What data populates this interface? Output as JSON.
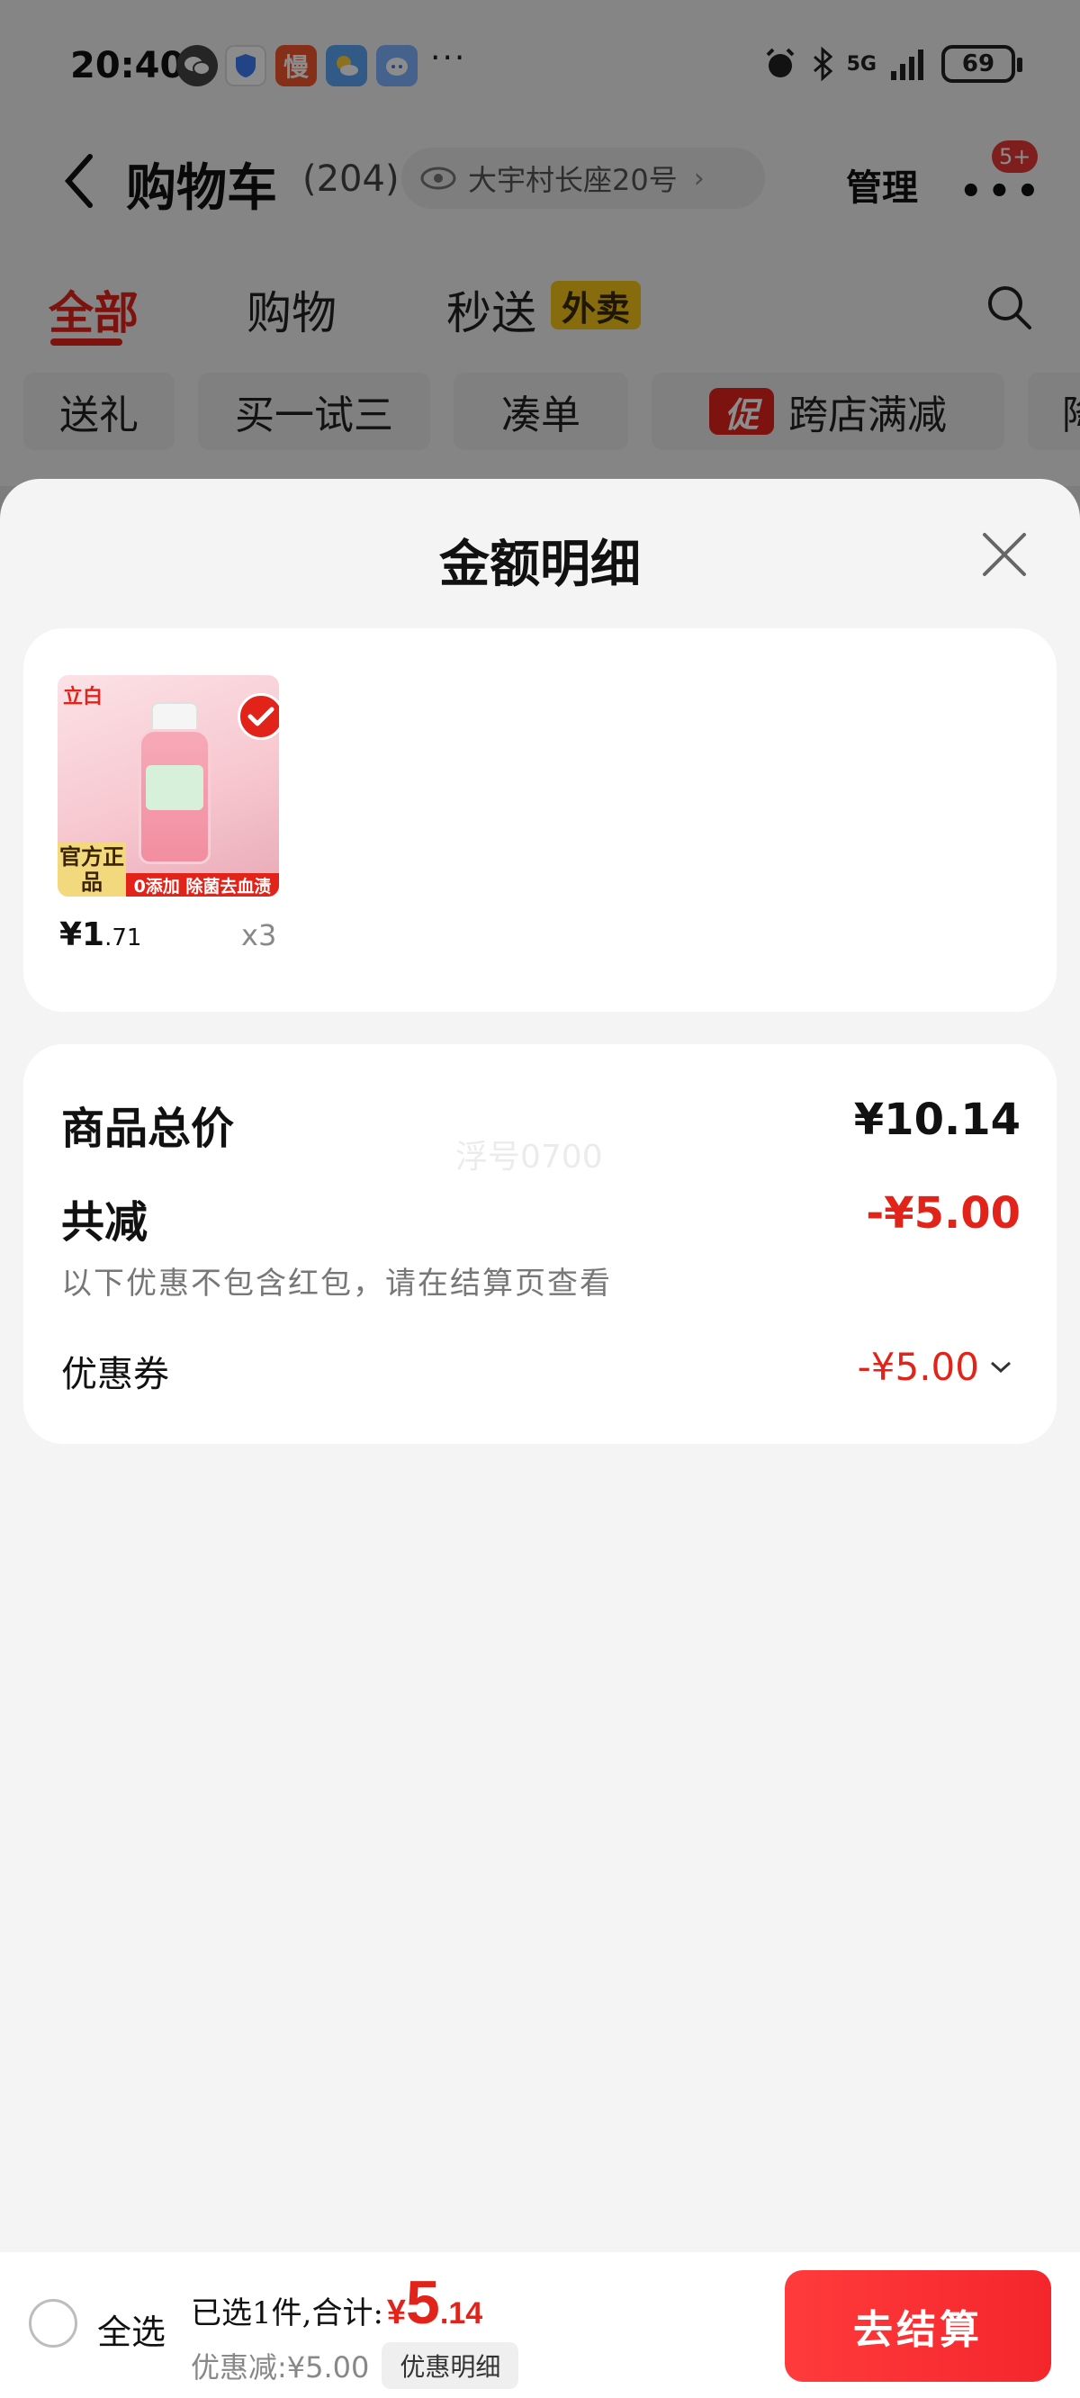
{
  "status_bar": {
    "time": "20:40",
    "apps": [
      "wechat-icon",
      "shield-app-icon",
      "慢",
      "weather-app-icon",
      "assistant-app-icon"
    ],
    "overflow": "···",
    "network": "5G",
    "battery": "69"
  },
  "nav": {
    "title": "购物车",
    "count": "(204)",
    "address": "大宇村长座20号",
    "manage": "管理",
    "more_badge": "5+"
  },
  "tabs": {
    "all": "全部",
    "shopping": "购物",
    "instant": "秒送",
    "instant_badge": "外卖"
  },
  "chips": [
    "送礼",
    "买一试三",
    "凑单",
    "跨店满减",
    "降"
  ],
  "chip_promo_tag": "促",
  "sheet": {
    "title": "金额明细",
    "item": {
      "brand": "立白",
      "official": "官方正品",
      "ribbon": "0添加 除菌去血渍",
      "price_int": "¥1",
      "price_dec": ".71",
      "qty": "x3"
    },
    "summary": {
      "total_label": "商品总价",
      "total_value": "¥10.14",
      "reduce_label": "共减",
      "reduce_value": "-¥5.00",
      "note": "以下优惠不包含红包，请在结算页查看",
      "coupon_label": "优惠券",
      "coupon_value": "-¥5.00",
      "watermark": "浮号0700"
    }
  },
  "bottom_bar": {
    "select_all": "全选",
    "selected_text": "已选1件,合计:",
    "total_currency": "¥",
    "total_int": "5",
    "total_dec": ".14",
    "discount_text": "优惠减:¥5.00",
    "detail_button": "优惠明细",
    "checkout": "去结算"
  },
  "colors": {
    "accent_red": "#e2231a",
    "badge_yellow": "#f5c518"
  }
}
